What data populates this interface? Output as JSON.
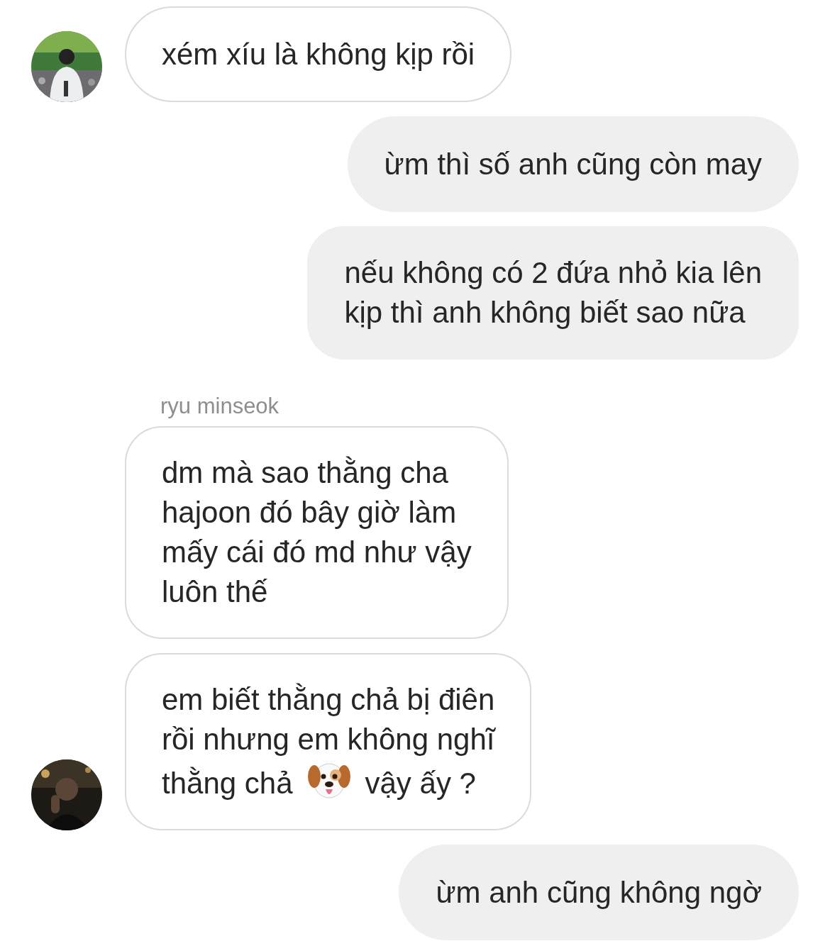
{
  "messages": [
    {
      "kind": "incoming",
      "avatar": true,
      "segments": [
        {
          "kind": "text",
          "lines": [
            "xém xíu là không kịp rồi"
          ]
        }
      ]
    },
    {
      "kind": "outgoing",
      "segments": [
        {
          "kind": "text",
          "lines": [
            "ừm thì số anh cũng còn may"
          ]
        }
      ]
    },
    {
      "kind": "outgoing",
      "segments": [
        {
          "kind": "text",
          "lines": [
            "nếu không có 2 đứa nhỏ kia lên",
            "kịp thì anh không biết sao nữa"
          ]
        }
      ]
    },
    {
      "kind": "incoming",
      "avatar": false,
      "sender": "ryu minseok",
      "segments": [
        {
          "kind": "text",
          "lines": [
            "dm mà sao thằng cha",
            "hajoon đó bây giờ làm",
            "mấy cái đó md như vậy",
            "luôn thế"
          ]
        }
      ]
    },
    {
      "kind": "incoming",
      "avatar": true,
      "segments": [
        {
          "kind": "text",
          "lines": [
            "em biết thằng chả bị điên",
            "rồi nhưng em không nghĩ"
          ]
        },
        {
          "kind": "inline",
          "text": "thằng chả"
        },
        {
          "kind": "emoji"
        },
        {
          "kind": "inline",
          "text": "vậy ấy ?"
        }
      ]
    },
    {
      "kind": "outgoing",
      "segments": [
        {
          "kind": "text",
          "lines": [
            "ừm anh cũng không ngờ"
          ]
        }
      ]
    }
  ]
}
